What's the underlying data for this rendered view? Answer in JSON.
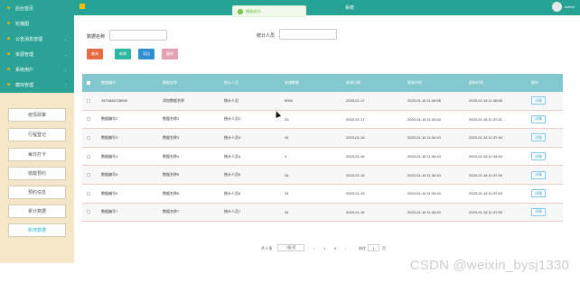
{
  "sidebar": {
    "items": [
      {
        "label": "后台首页",
        "icon": "home-icon"
      },
      {
        "label": "轮播图",
        "icon": "image-icon"
      },
      {
        "label": "公告消息管理",
        "icon": "notice-icon"
      },
      {
        "label": "资源管理",
        "icon": "resource-icon"
      },
      {
        "label": "系统用户",
        "icon": "user-icon"
      },
      {
        "label": "模块管理",
        "icon": "module-icon"
      }
    ],
    "sub_items": [
      {
        "label": "疫情政策"
      },
      {
        "label": "行程登记"
      },
      {
        "label": "每日打卡"
      },
      {
        "label": "核酸预约"
      },
      {
        "label": "预约信息"
      },
      {
        "label": "累计数据"
      },
      {
        "label": "新增数据"
      }
    ]
  },
  "topbar": {
    "system_title": "系统",
    "user": "admin"
  },
  "toast": {
    "message": "播放成功!"
  },
  "search": {
    "field1_label": "数据名称",
    "field2_label": "统计人员",
    "field1_value": "",
    "field2_value": ""
  },
  "buttons": {
    "query": "查询",
    "add": "新增",
    "export": "导出",
    "delete": "删除"
  },
  "colors": {
    "topbar": "#26a395",
    "sidebar_dark": "#2aa396",
    "sidebar_light": "#f5e6c8",
    "btn_query": "#e56b44",
    "btn_add": "#2bb6a6",
    "btn_export": "#2f8fd0",
    "btn_delete": "#e5a0b4",
    "table_header": "#82c8ce"
  },
  "table": {
    "columns": [
      "数据编号",
      "数据名称",
      "统计人员",
      "新增数量",
      "新增日期",
      "更新时间",
      "更新时间",
      "操作"
    ],
    "rows": [
      [
        "1673848728690",
        "添加数据名称",
        "统计人员",
        "5000",
        "2023-01-17",
        "2023-01-16 11:45:58",
        "2023-01-16 11:45:58",
        "详情"
      ],
      [
        "数据编号2",
        "数据名称2",
        "统计人员2",
        "33",
        "2023-01-17",
        "2023-01-16 11:34:40",
        "2023-01-16 11:37:41",
        "详情"
      ],
      [
        "数据编号3",
        "数据名称3",
        "统计人员3",
        "44",
        "2023-01-18",
        "2023-01-16 11:34:40",
        "2023-01-16 11:37:46",
        "详情"
      ],
      [
        "数据编号4",
        "数据名称4",
        "统计人员4",
        "4",
        "2023-01-16",
        "2023-01-16 11:34:40",
        "2023-01-16 11:34:40",
        "详情"
      ],
      [
        "数据编号5",
        "数据名称5",
        "统计人员5",
        "34",
        "2023-01-15",
        "2023-01-16 11:34:40",
        "2023-01-16 11:37:49",
        "详情"
      ],
      [
        "数据编号6",
        "数据名称6",
        "统计人员6",
        "34",
        "2023-01-19",
        "2023-01-16 11:34:40",
        "2023-01-16 11:37:54",
        "详情"
      ],
      [
        "数据编号7",
        "数据名称7",
        "统计人员7",
        "34",
        "2023-01-18",
        "2023-01-16 11:34:40",
        "2023-01-16 11:37:59",
        "详情"
      ]
    ]
  },
  "pagination": {
    "total": "共 9 条",
    "page_size": "7条/页",
    "prev": "‹",
    "page1": "1",
    "page2": "2",
    "next": "›",
    "goto": "前往",
    "goto_value": "1",
    "page_unit": "页"
  },
  "watermark": "CSDN @weixin_bysj1330"
}
